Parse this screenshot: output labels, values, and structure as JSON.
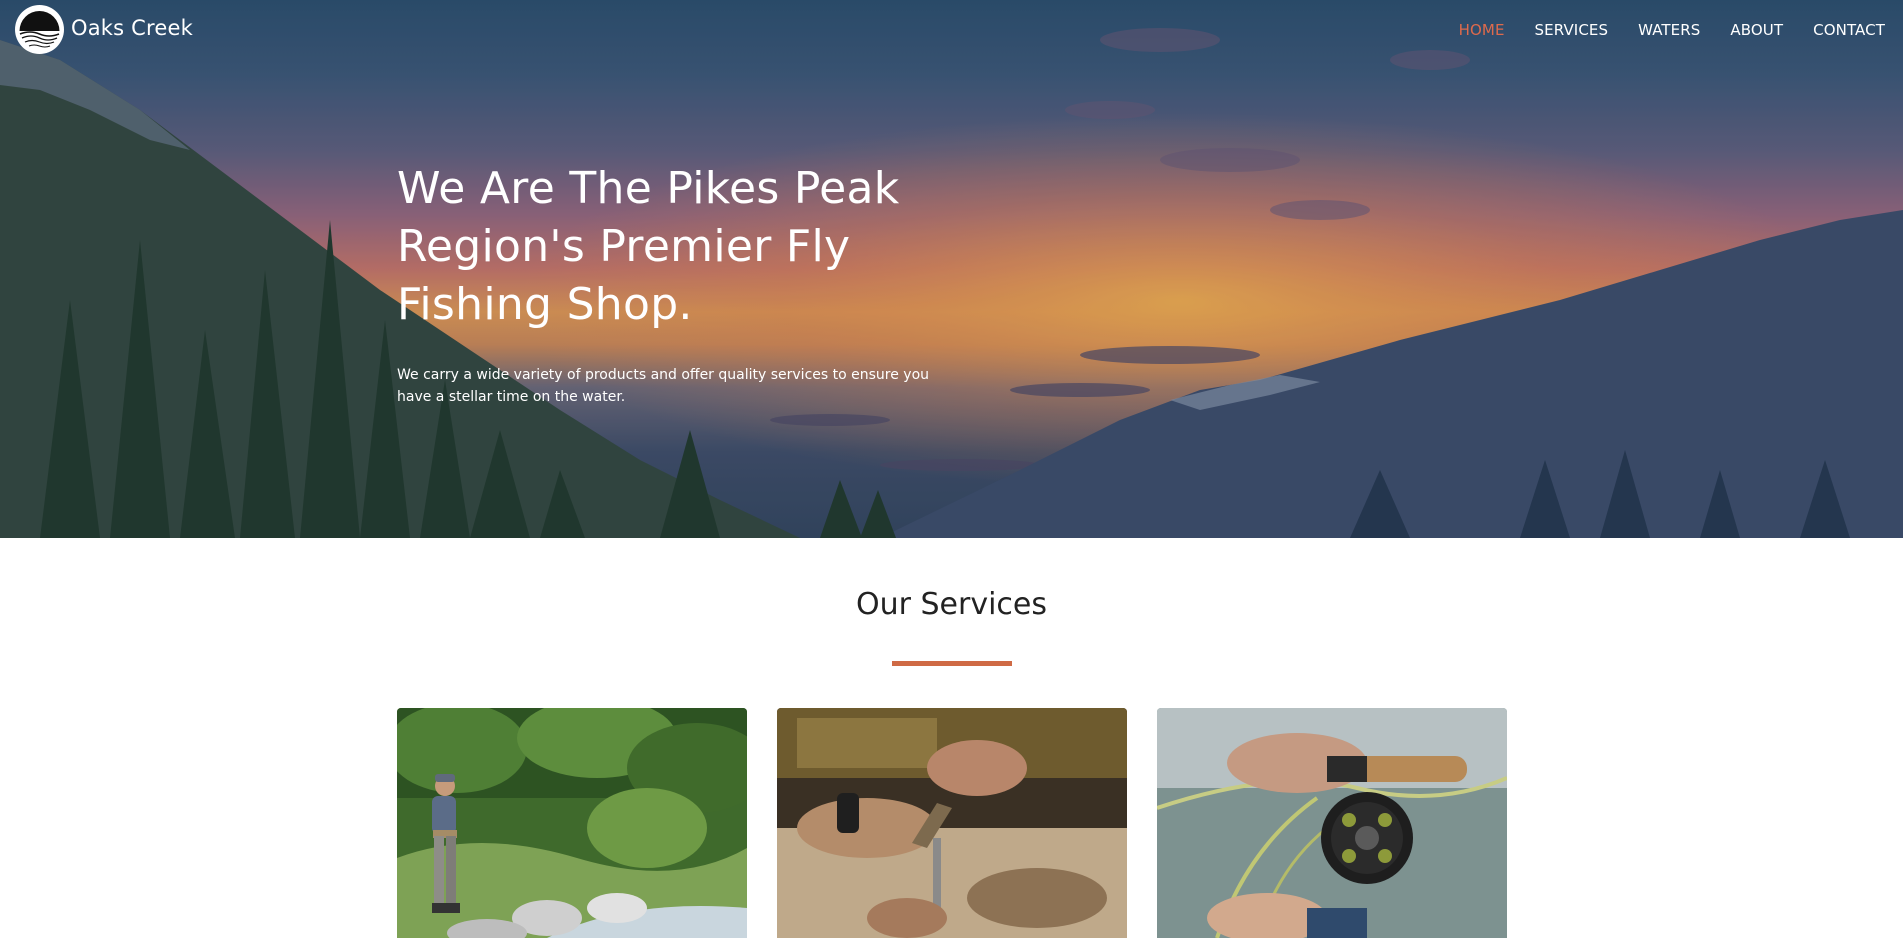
{
  "brand": {
    "name": "Oaks Creek"
  },
  "nav": {
    "items": [
      {
        "label": "HOME",
        "active": true
      },
      {
        "label": "SERVICES",
        "active": false
      },
      {
        "label": "WATERS",
        "active": false
      },
      {
        "label": "ABOUT",
        "active": false
      },
      {
        "label": "CONTACT",
        "active": false
      }
    ]
  },
  "hero": {
    "title": "We Are The Pikes Peak Region's Premier Fly Fishing Shop.",
    "subtitle": "We carry a wide variety of products and offer quality services to ensure you have a stellar time on the water."
  },
  "services": {
    "title": "Our Services",
    "cards": [
      {
        "image": "angler-in-stream-photo"
      },
      {
        "image": "fly-tying-photo"
      },
      {
        "image": "fly-reel-photo"
      }
    ]
  },
  "colors": {
    "accent": "#de6a4c",
    "rule": "#cf6a45",
    "nav_text": "#ffffff",
    "heading_text": "#222222"
  }
}
